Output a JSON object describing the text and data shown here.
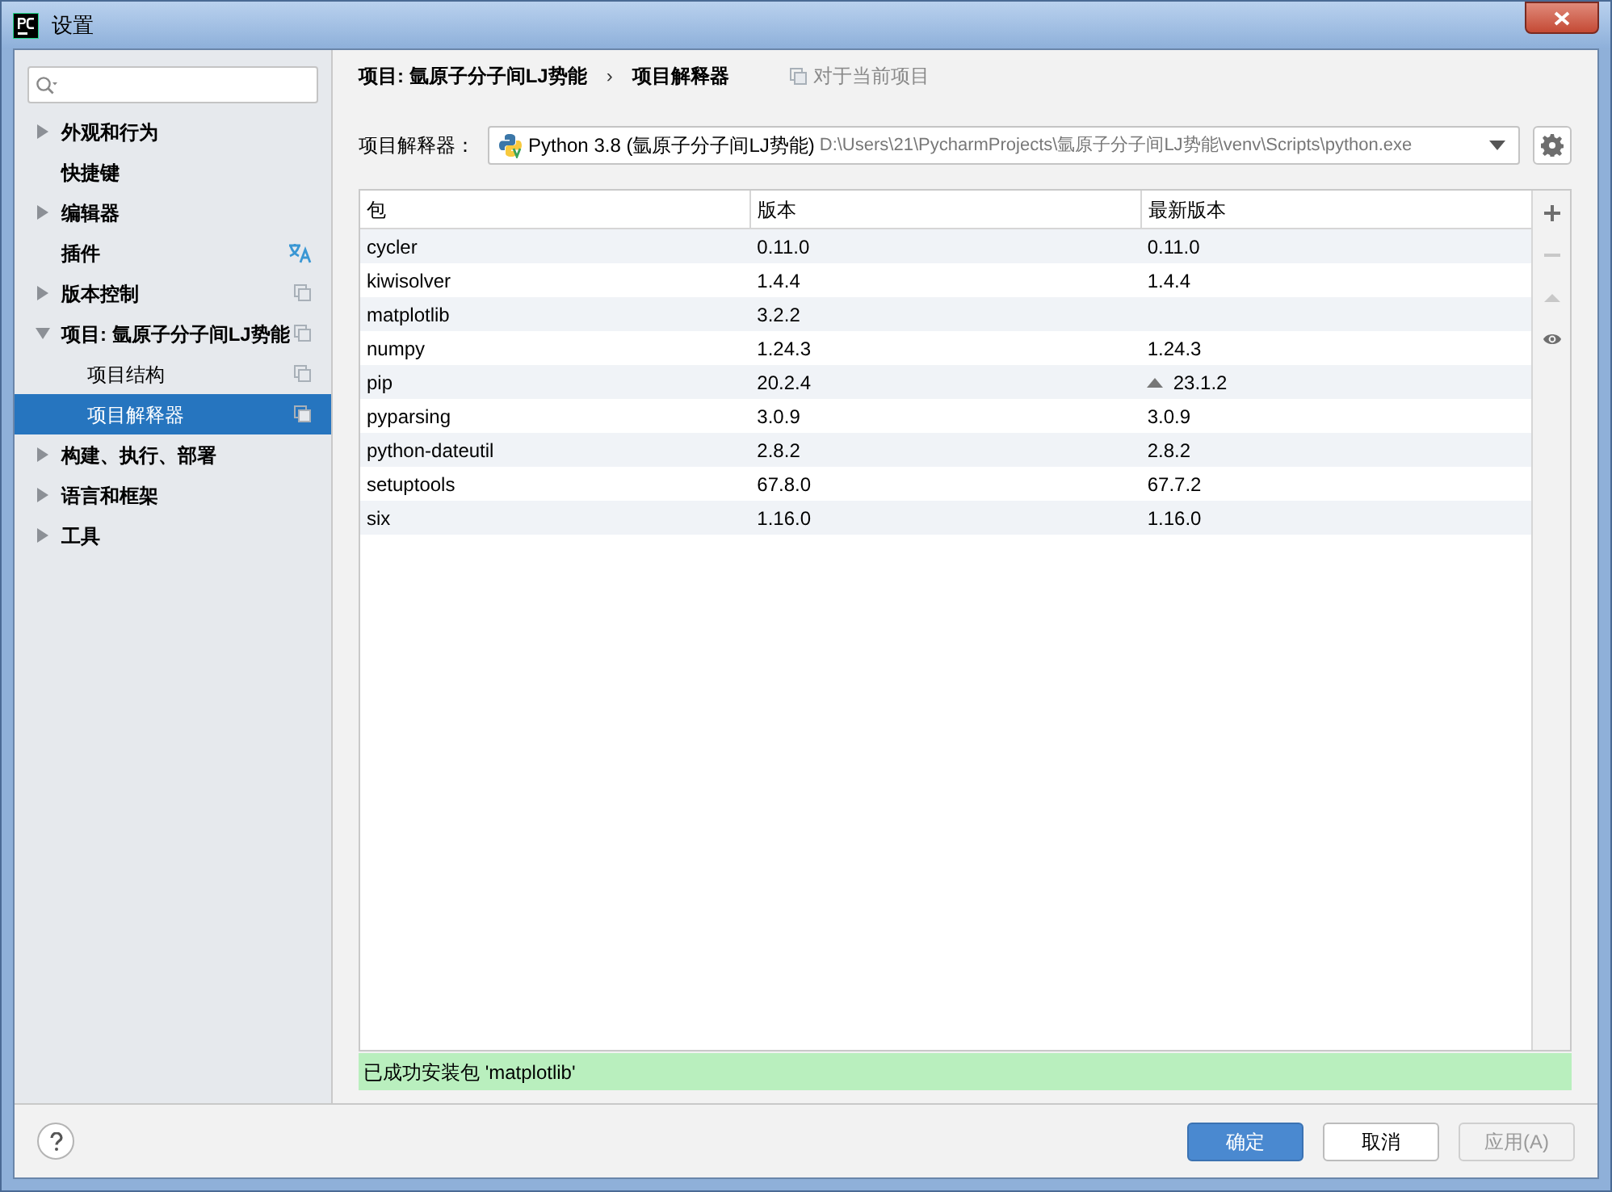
{
  "window": {
    "title": "设置"
  },
  "search": {
    "kind": "filter"
  },
  "sidebar": {
    "items": [
      {
        "label": "外观和行为",
        "expanded": false,
        "selected": false
      },
      {
        "label": "快捷键",
        "selected": false
      },
      {
        "label": "编辑器",
        "expanded": false,
        "selected": false
      },
      {
        "label": "插件",
        "selected": false,
        "kind": "translate"
      },
      {
        "label": "版本控制",
        "expanded": false,
        "selected": false,
        "kind": "copy"
      },
      {
        "label": "项目: 氩原子分子间LJ势能",
        "expanded": true,
        "selected": false,
        "kind": "copy",
        "children": [
          {
            "label": "项目结构",
            "selected": false,
            "kind": "copy"
          },
          {
            "label": "项目解释器",
            "selected": true,
            "kind": "copy"
          }
        ]
      },
      {
        "label": "构建、执行、部署",
        "expanded": false,
        "selected": false
      },
      {
        "label": "语言和框架",
        "expanded": false,
        "selected": false
      },
      {
        "label": "工具",
        "expanded": false,
        "selected": false
      }
    ]
  },
  "breadcrumb": {
    "items": [
      "项目: 氩原子分子间LJ势能",
      "项目解释器"
    ],
    "separator": "›",
    "scope": "对于当前项目"
  },
  "interpreter": {
    "label": "项目解释器：",
    "name": "Python 3.8 (氩原子分子间LJ势能)",
    "path": "D:\\Users\\21\\PycharmProjects\\氩原子分子间LJ势能\\venv\\Scripts\\python.exe"
  },
  "table": {
    "columns": [
      "包",
      "版本",
      "最新版本"
    ],
    "rows": [
      {
        "cells": [
          "cycler",
          "0.11.0",
          "0.11.0"
        ],
        "upgrade": false
      },
      {
        "cells": [
          "kiwisolver",
          "1.4.4",
          "1.4.4"
        ],
        "upgrade": false
      },
      {
        "cells": [
          "matplotlib",
          "3.2.2",
          ""
        ],
        "upgrade": false
      },
      {
        "cells": [
          "numpy",
          "1.24.3",
          "1.24.3"
        ],
        "upgrade": false
      },
      {
        "cells": [
          "pip",
          "20.2.4",
          "23.1.2"
        ],
        "upgrade": true
      },
      {
        "cells": [
          "pyparsing",
          "3.0.9",
          "3.0.9"
        ],
        "upgrade": false
      },
      {
        "cells": [
          "python-dateutil",
          "2.8.2",
          "2.8.2"
        ],
        "upgrade": false
      },
      {
        "cells": [
          "setuptools",
          "67.8.0",
          "67.7.2"
        ],
        "upgrade": false
      },
      {
        "cells": [
          "six",
          "1.16.0",
          "1.16.0"
        ],
        "upgrade": false
      }
    ]
  },
  "table_tools": [
    {
      "kind": "add",
      "disabled": false
    },
    {
      "kind": "remove",
      "disabled": true
    },
    {
      "kind": "upgrade",
      "disabled": true
    },
    {
      "kind": "show",
      "disabled": false
    }
  ],
  "status": "已成功安装包 'matplotlib'",
  "buttons": [
    {
      "label": "确定",
      "kind": "primary",
      "disabled": false
    },
    {
      "label": "取消",
      "kind": "normal",
      "disabled": false
    },
    {
      "label": "应用(A)",
      "kind": "normal",
      "disabled": true
    }
  ]
}
